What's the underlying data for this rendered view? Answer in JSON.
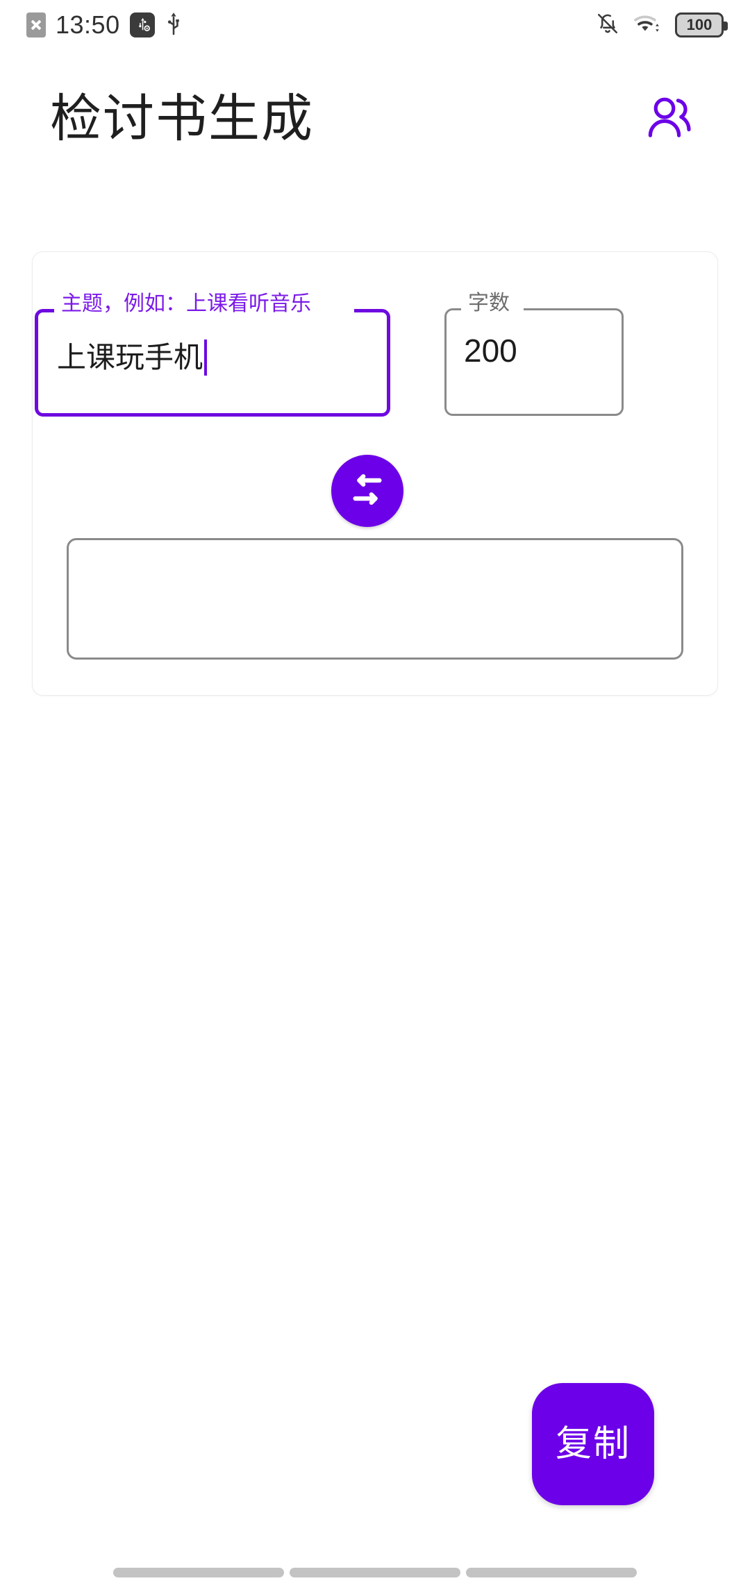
{
  "status_bar": {
    "time": "13:50",
    "battery_level": "100",
    "left_icons": [
      "sim-card-x-icon",
      "usb-debugging-icon",
      "usb-icon"
    ],
    "right_icons": [
      "bell-off-icon",
      "wifi-icon",
      "battery-icon"
    ]
  },
  "app_bar": {
    "title": "检讨书生成",
    "action_icon": "users-icon"
  },
  "form": {
    "topic": {
      "label": "主题，例如：上课看听音乐",
      "value": "上课玩手机",
      "focused": true
    },
    "word_count": {
      "label": "字数",
      "value": "200",
      "focused": false
    },
    "swap_button": {
      "icon": "swap-horizontal-icon"
    },
    "output": {
      "value": "",
      "placeholder": ""
    }
  },
  "copy_button": {
    "label": "复制"
  },
  "colors": {
    "accent": "#6c00e8",
    "label_purple": "#7b19e8",
    "outline_gray": "#8a8a8a",
    "card_border": "#ececed",
    "nav_pill": "#c3c3c3"
  },
  "nav_bar": {
    "pills": [
      "back-pill",
      "home-pill",
      "recents-pill"
    ]
  }
}
